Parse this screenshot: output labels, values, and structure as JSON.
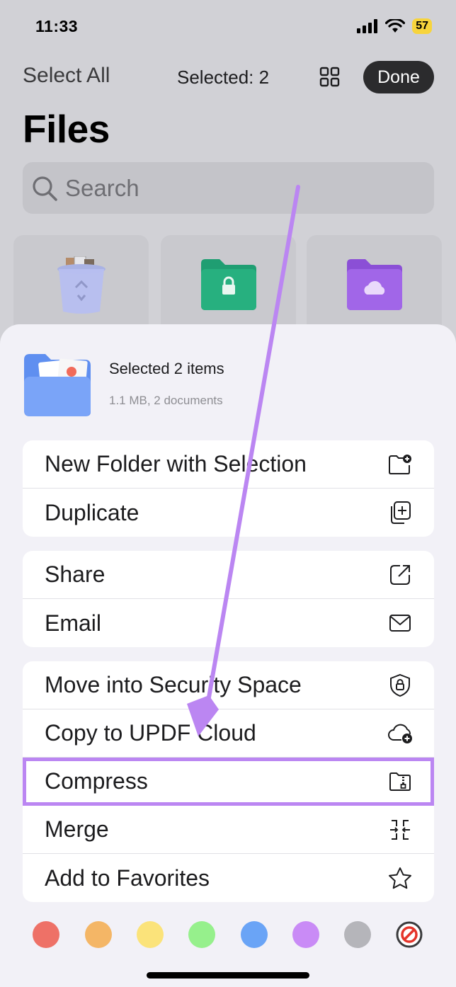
{
  "status_bar": {
    "time": "11:33",
    "battery": "57"
  },
  "header": {
    "select_all": "Select All",
    "selected": "Selected: 2",
    "done": "Done",
    "title": "Files"
  },
  "search": {
    "placeholder": "Search"
  },
  "sheet": {
    "selection_title": "Selected 2 items",
    "selection_subtitle": "1.1 MB, 2 documents",
    "groups": [
      [
        {
          "label": "New Folder with Selection",
          "icon": "new-folder-icon"
        },
        {
          "label": "Duplicate",
          "icon": "duplicate-icon"
        }
      ],
      [
        {
          "label": "Share",
          "icon": "share-icon"
        },
        {
          "label": "Email",
          "icon": "mail-icon"
        }
      ],
      [
        {
          "label": "Move into Security Space",
          "icon": "shield-lock-icon"
        },
        {
          "label": "Copy to UPDF Cloud",
          "icon": "cloud-add-icon"
        },
        {
          "label": "Compress",
          "icon": "compress-icon",
          "highlighted": true
        },
        {
          "label": "Merge",
          "icon": "merge-icon"
        },
        {
          "label": "Add to Favorites",
          "icon": "star-icon"
        }
      ]
    ],
    "color_tags": [
      "#ee7167",
      "#f4b666",
      "#fbe37a",
      "#96f08c",
      "#6aa4f6",
      "#c98bf6",
      "#b5b5ba",
      "none"
    ]
  },
  "colors": {
    "accent_purple": "#bb86f2",
    "done_button": "#2b2b2d"
  }
}
